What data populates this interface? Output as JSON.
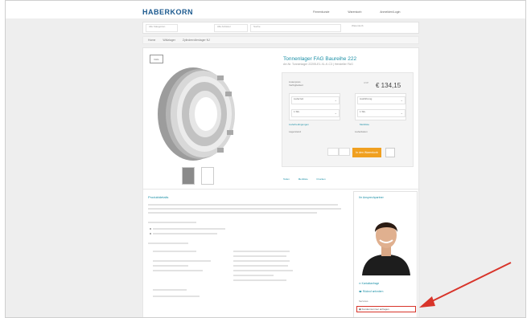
{
  "header": {
    "logo": "HABERKORN",
    "links": [
      "Firmenkunde",
      "Warenkorb",
      "Anmelden/Login"
    ]
  },
  "search": {
    "category": "Alle Kategorien",
    "filter": "Alle Anbieter",
    "query": "Suche",
    "cart_label": "Warenkorb"
  },
  "nav": {
    "items": [
      "Home",
      "Wälzlager",
      "Zylinderrollenlager NJ"
    ]
  },
  "product": {
    "badge": "FAG",
    "title": "Tonnenlager FAG Baureihe 222",
    "subtitle": "Art-Nr. Tonnenlager 22205-E1-XL-K-C3 | Hersteller FAG",
    "price": "€ 134,15",
    "price_note": "Listenpreis",
    "old_price_label": "UVP",
    "availability_label": "Verfügbarkeit",
    "sel1_label": "Lieferzeit",
    "sel1_value": "1 Stk.",
    "sel2_label": "Ausführung",
    "sel2_value": "1 Stk.",
    "details_link": "Lieferbedingungen",
    "compare_link": "Merkliste",
    "stock_label": "Lagerstand",
    "delivery_label": "Lieferdatum",
    "add_to_cart": "In den Warenkorb",
    "actions": [
      "Teilen",
      "Merkliste",
      "Drucken"
    ]
  },
  "info": {
    "title": "Produktdetails"
  },
  "contact": {
    "title": "Ihr Ansprechpartner",
    "links": [
      "Kontaktanfrage",
      "Rückruf anfordern"
    ],
    "services_label": "Services",
    "highlight_link": "Kundennummer anfragen"
  },
  "colors": {
    "brand": "#1c5a8f",
    "accent": "#1b8fa6",
    "cta": "#f0a020",
    "annotation": "#d8342a"
  }
}
